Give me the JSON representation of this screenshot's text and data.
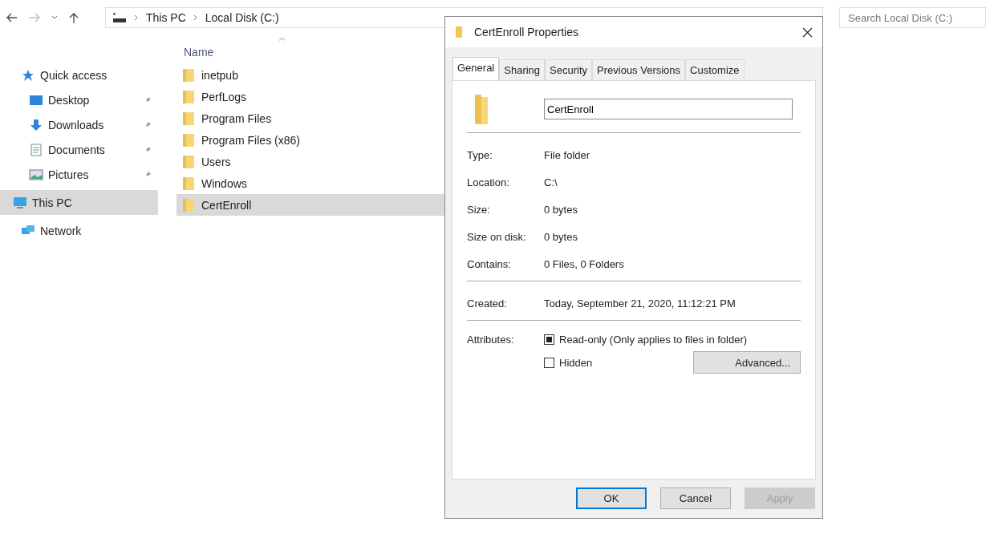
{
  "address_bar": {
    "path": [
      "This PC",
      "Local Disk (C:)"
    ]
  },
  "search": {
    "placeholder": "Search Local Disk (C:)"
  },
  "sidebar": {
    "items": [
      {
        "label": "Quick access",
        "selected": false,
        "children": [
          {
            "label": "Desktop",
            "pinned": true,
            "selected": false
          },
          {
            "label": "Downloads",
            "pinned": true,
            "selected": false
          },
          {
            "label": "Documents",
            "pinned": true,
            "selected": false
          },
          {
            "label": "Pictures",
            "pinned": true,
            "selected": false
          }
        ]
      },
      {
        "label": "This PC",
        "selected": true
      },
      {
        "label": "Network",
        "selected": false
      }
    ]
  },
  "file_list": {
    "column": "Name",
    "rows": [
      {
        "name": "inetpub",
        "selected": false
      },
      {
        "name": "PerfLogs",
        "selected": false
      },
      {
        "name": "Program Files",
        "selected": false
      },
      {
        "name": "Program Files (x86)",
        "selected": false
      },
      {
        "name": "Users",
        "selected": false
      },
      {
        "name": "Windows",
        "selected": false
      },
      {
        "name": "CertEnroll",
        "selected": true
      }
    ]
  },
  "dialog": {
    "title": "CertEnroll Properties",
    "tabs": [
      {
        "label": "General",
        "selected": true
      },
      {
        "label": "Sharing",
        "selected": false
      },
      {
        "label": "Security",
        "selected": false
      },
      {
        "label": "Previous Versions",
        "selected": false
      },
      {
        "label": "Customize",
        "selected": false
      }
    ],
    "name_field": "CertEnroll",
    "groups": [
      [
        {
          "label": "Type:",
          "value": "File folder"
        },
        {
          "label": "Location:",
          "value": "C:\\"
        },
        {
          "label": "Size:",
          "value": "0 bytes"
        },
        {
          "label": "Size on disk:",
          "value": "0 bytes"
        },
        {
          "label": "Contains:",
          "value": "0 Files, 0 Folders"
        }
      ],
      [
        {
          "label": "Created:",
          "value": "Today, September 21, 2020, 11:12:21 PM"
        }
      ]
    ],
    "attributes_label": "Attributes:",
    "attributes": [
      {
        "label": "Read-only (Only applies to files in folder)",
        "indeterminate": true
      },
      {
        "label": "Hidden",
        "indeterminate": false
      }
    ],
    "advanced_button": "Advanced...",
    "buttons": [
      {
        "label": "OK",
        "default": true,
        "disabled": false
      },
      {
        "label": "Cancel",
        "default": false,
        "disabled": false
      },
      {
        "label": "Apply",
        "default": false,
        "disabled": true
      }
    ]
  }
}
